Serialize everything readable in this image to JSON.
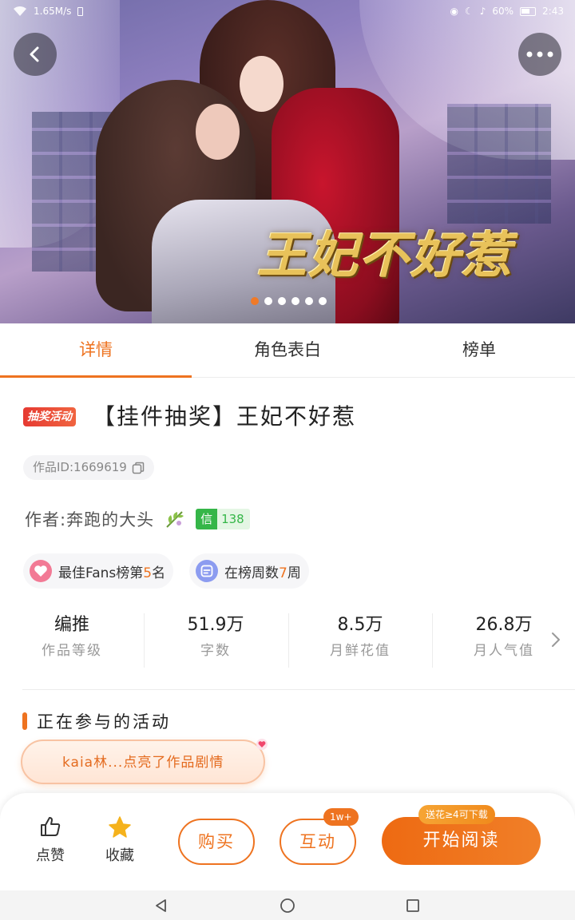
{
  "status_bar": {
    "net_speed": "1.65M/s",
    "battery": "60%",
    "time": "2:43"
  },
  "banner": {
    "cover_title": "王妃不好惹",
    "slide_count": 6,
    "active_slide": 1
  },
  "tabs": [
    {
      "label": "详情",
      "active": true
    },
    {
      "label": "角色表白",
      "active": false
    },
    {
      "label": "榜单",
      "active": false
    }
  ],
  "work": {
    "badge": "抽奖活动",
    "title": "【挂件抽奖】王妃不好惹",
    "id_label": "作品ID:1669619",
    "author": "作者:奔跑的大头",
    "xin_label": "信",
    "xin_count": "138"
  },
  "pills": {
    "fans_prefix": "最佳Fans榜第",
    "fans_rank": "5",
    "fans_suffix": "名",
    "weeks_prefix": "在榜周数",
    "weeks_count": "7",
    "weeks_suffix": "周"
  },
  "stats": [
    {
      "value": "编推",
      "label": "作品等级"
    },
    {
      "value": "51.9万",
      "label": "字数"
    },
    {
      "value": "8.5万",
      "label": "月鲜花值"
    },
    {
      "value": "26.8万",
      "label": "月人气值"
    }
  ],
  "activity": {
    "section_title": "正在参与的活动",
    "toast": "kaia林...点亮了作品剧情"
  },
  "action_bar": {
    "like_label": "点赞",
    "favorite_label": "收藏",
    "buy_label": "购买",
    "interact_label": "互动",
    "interact_badge": "1w+",
    "read_label": "开始阅读",
    "read_tip": "送花≥4可下载"
  },
  "colors": {
    "accent": "#ee7320",
    "lottery_badge": "#e63a32",
    "xin_green": "#35b648"
  }
}
